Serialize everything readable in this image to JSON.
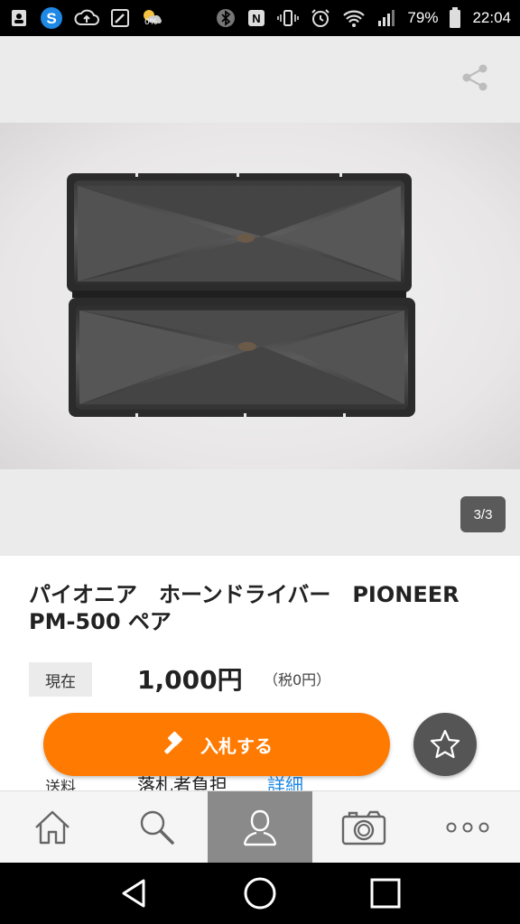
{
  "status_bar": {
    "weather_percent": "0%",
    "battery": "79%",
    "time": "22:04"
  },
  "icons": {
    "share": "share-icon",
    "gavel": "gavel-icon",
    "star": "star-icon",
    "home": "home-icon",
    "search": "search-icon",
    "user": "user-icon",
    "camera": "camera-icon",
    "more": "more-icon"
  },
  "image": {
    "counter": "3/3",
    "description_kind": "two horn drivers on white cloth"
  },
  "listing": {
    "title": "パイオニア　ホーンドライバー　PIONEER PM-500 ペア",
    "price_label": "現在",
    "price": "1,000円",
    "tax": "（税0円）",
    "shipping_label": "送料",
    "shipping_value": "落札者負担",
    "shipping_link": "詳細"
  },
  "actions": {
    "bid_label": "入札する"
  },
  "colors": {
    "accent": "#ff7a00",
    "link": "#1e88e5",
    "active_tab": "#8a8a8a"
  }
}
